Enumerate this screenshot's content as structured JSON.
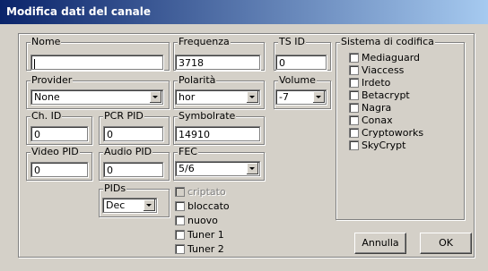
{
  "window": {
    "title": "Modifica dati del canale"
  },
  "groups": {
    "nome": "Nome",
    "frequenza": "Frequenza",
    "ts_id": "TS ID",
    "sistema": "Sistema di codifica",
    "provider": "Provider",
    "polarita": "Polarità",
    "volume": "Volume",
    "ch_id": "Ch. ID",
    "pcr_pid": "PCR PID",
    "symbolrate": "Symbolrate",
    "video_pid": "Video PID",
    "audio_pid": "Audio PID",
    "fec": "FEC",
    "pids": "PIDs"
  },
  "fields": {
    "nome": "",
    "frequenza": "3718",
    "ts_id": "0",
    "provider": "None",
    "polarita": "hor",
    "volume": "-7",
    "ch_id": "0",
    "pcr_pid": "0",
    "symbolrate": "14910",
    "video_pid": "0",
    "audio_pid": "0",
    "fec": "5/6",
    "pids": "Dec"
  },
  "sistema_items": [
    "Mediaguard",
    "Viaccess",
    "Irdeto",
    "Betacrypt",
    "Nagra",
    "Conax",
    "Cryptoworks",
    "SkyCrypt"
  ],
  "flags": {
    "criptato": "criptato",
    "bloccato": "bloccato",
    "nuovo": "nuovo",
    "tuner1": "Tuner 1",
    "tuner2": "Tuner 2"
  },
  "buttons": {
    "annulla": "Annulla",
    "ok": "OK"
  }
}
